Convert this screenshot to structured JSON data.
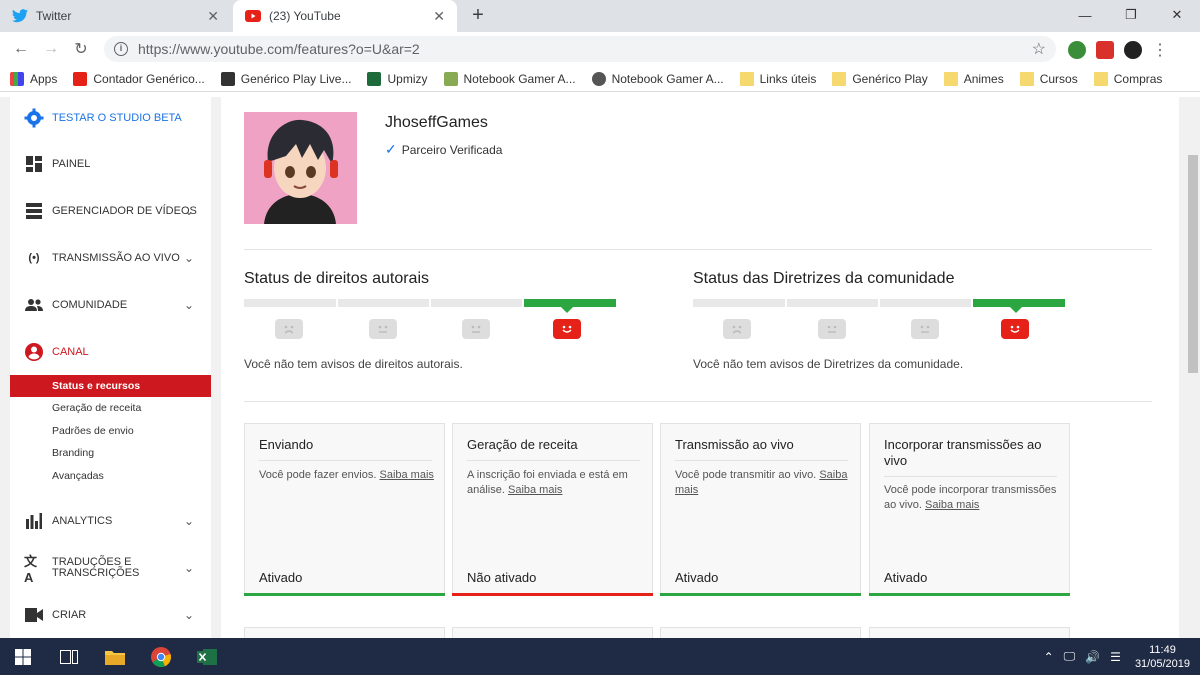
{
  "browser": {
    "tabs": [
      {
        "label": "Twitter",
        "icon": "twitter-icon"
      },
      {
        "label": "(23) YouTube",
        "icon": "youtube-icon"
      }
    ],
    "url_prefix": "https://www.youtube.com",
    "url_path": "/features?o=U&ar=2",
    "bookmarks": [
      {
        "label": "Apps"
      },
      {
        "label": "Contador Genérico..."
      },
      {
        "label": "Genérico Play Live..."
      },
      {
        "label": "Upmizy"
      },
      {
        "label": "Notebook Gamer A..."
      },
      {
        "label": "Notebook Gamer A..."
      },
      {
        "label": "Links úteis"
      },
      {
        "label": "Genérico Play"
      },
      {
        "label": "Animes"
      },
      {
        "label": "Cursos"
      },
      {
        "label": "Compras"
      }
    ]
  },
  "sidebar": {
    "studio_beta": "TESTAR O STUDIO BETA",
    "items": [
      {
        "label": "PAINEL"
      },
      {
        "label": "GERENCIADOR DE VÍDEOS"
      },
      {
        "label": "TRANSMISSÃO AO VIVO"
      },
      {
        "label": "COMUNIDADE"
      },
      {
        "label": "CANAL"
      },
      {
        "label": "ANALYTICS"
      },
      {
        "label": "TRADUÇÕES E TRANSCRIÇÕES"
      },
      {
        "label": "CRIAR"
      }
    ],
    "channel_sub": [
      {
        "label": "Status e recursos"
      },
      {
        "label": "Geração de receita"
      },
      {
        "label": "Padrões de envio"
      },
      {
        "label": "Branding"
      },
      {
        "label": "Avançadas"
      }
    ]
  },
  "channel": {
    "name": "JhoseffGames",
    "verified": "Parceiro Verificada"
  },
  "copyright": {
    "title": "Status de direitos autorais",
    "note": "Você não tem avisos de direitos autorais."
  },
  "community": {
    "title": "Status das Diretrizes da comunidade",
    "note": "Você não tem avisos de Diretrizes da comunidade."
  },
  "cards": [
    {
      "title": "Enviando",
      "desc": "Você pode fazer envios.",
      "link": "Saiba mais",
      "status": "Ativado",
      "color": "#2ba640"
    },
    {
      "title": "Geração de receita",
      "desc": "A inscrição foi enviada e está em análise.",
      "link": "Saiba mais",
      "status": "Não ativado",
      "color": "#e62117"
    },
    {
      "title": "Transmissão ao vivo",
      "desc": "Você pode transmitir ao vivo.",
      "link": "Saiba mais",
      "status": "Ativado",
      "color": "#2ba640"
    },
    {
      "title": "Incorporar transmissões ao vivo",
      "desc": "Você pode incorporar transmissões ao vivo.",
      "link": "Saiba mais",
      "status": "Ativado",
      "color": "#2ba640"
    }
  ],
  "taskbar": {
    "time": "11:49",
    "date": "31/05/2019"
  },
  "colors": {
    "accent_red": "#cc181e",
    "good_green": "#2ba640",
    "link_blue": "#1a73e8"
  }
}
